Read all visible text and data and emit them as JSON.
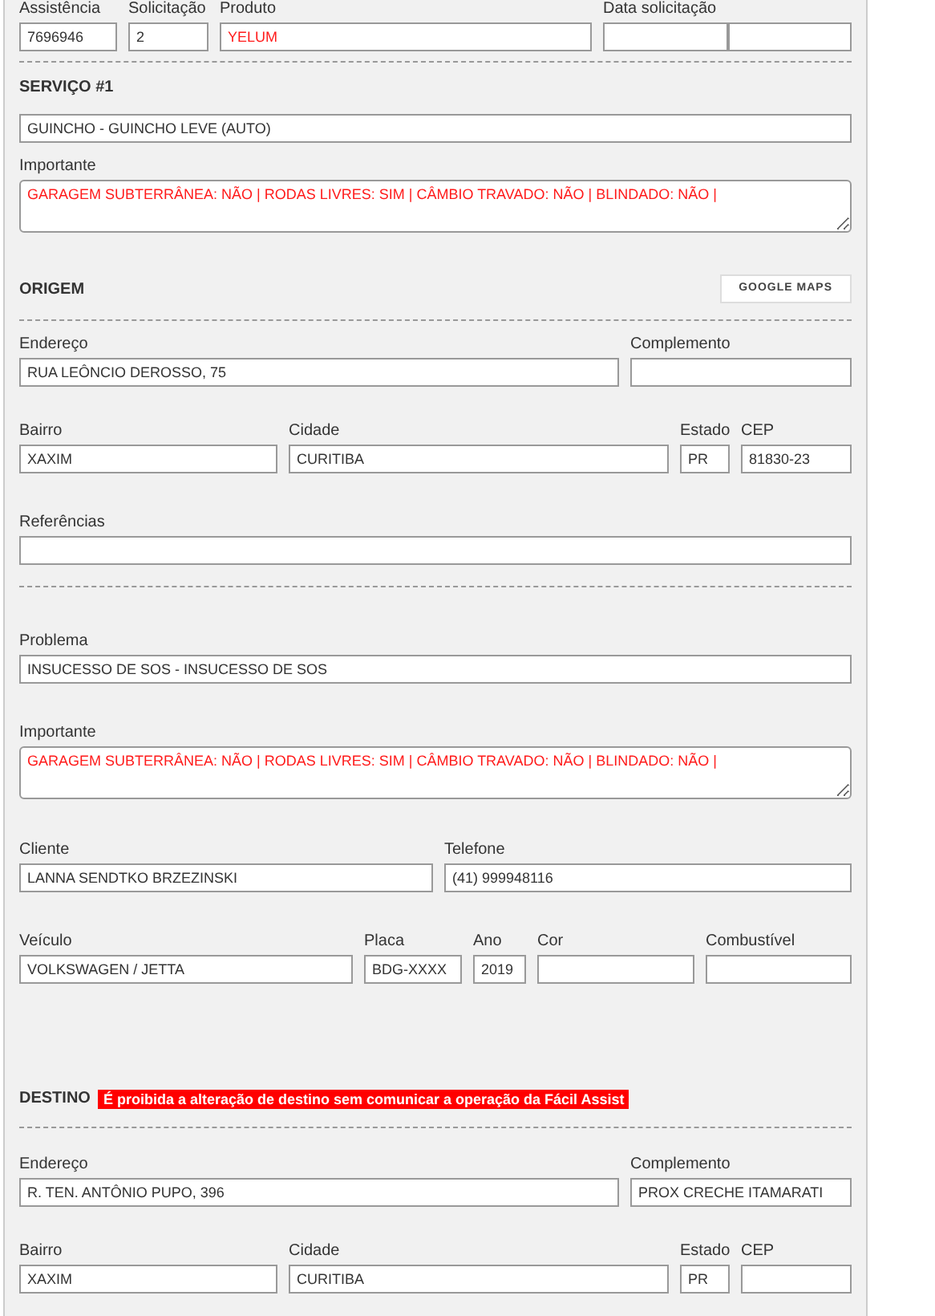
{
  "top_fields": [
    {
      "label": "Assistência",
      "value": "7696946"
    },
    {
      "label": "Solicitação",
      "value": "2"
    },
    {
      "label": "Produto",
      "value": "YELUM",
      "highlight": true
    },
    {
      "label": "Data solicitação"
    }
  ],
  "servico": {
    "title": "SERVIÇO #1",
    "value": "GUINCHO - GUINCHO LEVE (AUTO)",
    "important_label": "Importante",
    "important": "GARAGEM SUBTERRÂNEA: NÃO | RODAS LIVRES: SIM | CÂMBIO TRAVADO: NÃO | BLINDADO: NÃO |"
  },
  "origem": {
    "title": "ORIGEM",
    "button": "GOOGLE MAPS",
    "address_row": [
      {
        "label": "Endereço",
        "value": "RUA LEÔNCIO DEROSSO, 75"
      },
      {
        "label": "Complemento"
      }
    ],
    "city_row": [
      {
        "label": "Bairro",
        "value": "XAXIM"
      },
      {
        "label": "Cidade",
        "value": "CURITIBA"
      },
      {
        "label": "Estado",
        "value": "PR"
      },
      {
        "label": "CEP",
        "value": "81830-23"
      }
    ],
    "references": {
      "label": "Referências"
    }
  },
  "problema": {
    "label": "Problema",
    "value": "INSUCESSO DE SOS - INSUCESSO DE SOS",
    "important_label": "Importante",
    "important": "GARAGEM SUBTERRÂNEA: NÃO | RODAS LIVRES: SIM | CÂMBIO TRAVADO: NÃO | BLINDADO: NÃO |"
  },
  "client_row": [
    {
      "label": "Cliente",
      "value": "LANNA SENDTKO BRZEZINSKI"
    },
    {
      "label": "Telefone",
      "value": "(41) 999948116"
    }
  ],
  "vehicle_row": [
    {
      "label": "Veículo",
      "value": "VOLKSWAGEN / JETTA"
    },
    {
      "label": "Placa",
      "value": "BDG-XXXX"
    },
    {
      "label": "Ano",
      "value": "2019"
    },
    {
      "label": "Cor"
    },
    {
      "label": "Combustível"
    }
  ],
  "destino": {
    "title": "DESTINO",
    "warning": "É proibida a alteração de destino sem comunicar a operação da Fácil Assist",
    "address_row": [
      {
        "label": "Endereço",
        "value": "R. TEN. ANTÔNIO PUPO, 396"
      },
      {
        "label": "Complemento",
        "value": "PROX CRECHE ITAMARATI"
      }
    ],
    "city_row": [
      {
        "label": "Bairro",
        "value": "XAXIM"
      },
      {
        "label": "Cidade",
        "value": "CURITIBA"
      },
      {
        "label": "Estado",
        "value": "PR"
      },
      {
        "label": "CEP"
      }
    ]
  }
}
